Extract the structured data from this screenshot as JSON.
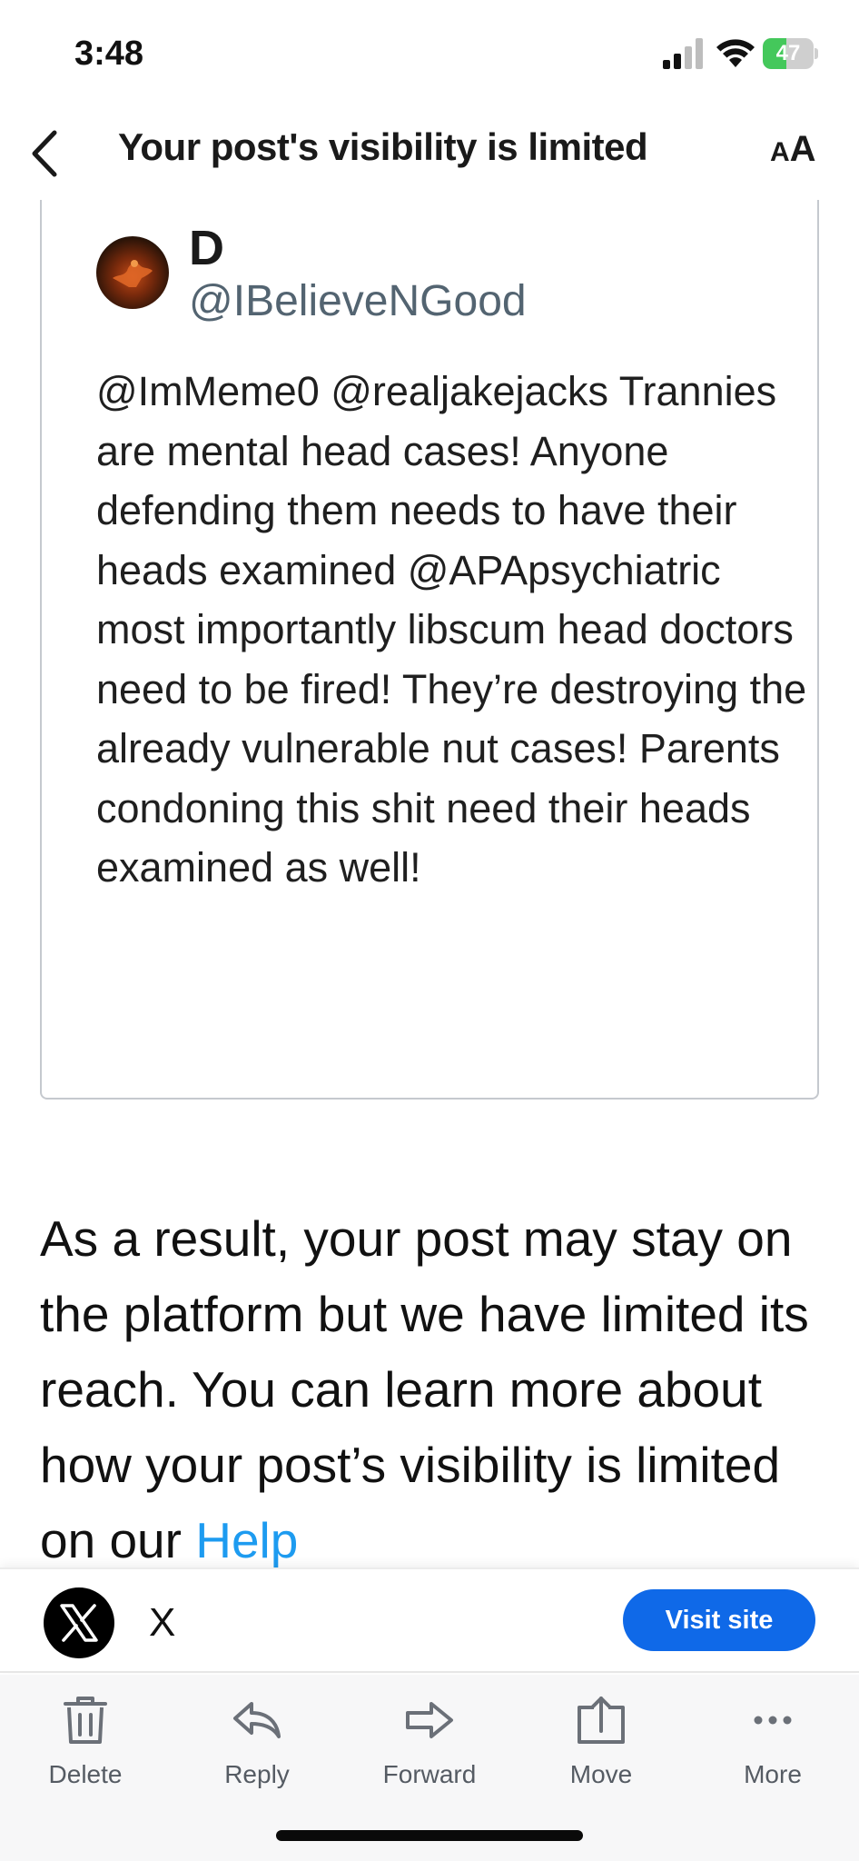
{
  "status_bar": {
    "time": "3:48",
    "battery_level": "47",
    "battery_fraction": 0.47,
    "battery_color": "#44c85b"
  },
  "header": {
    "title": "Your post's visibility is limited",
    "text_size_icon": "AA"
  },
  "tweet": {
    "name": "D",
    "handle": "@IBelieveNGood",
    "text": "@ImMeme0 @realjakejacks Trannies are mental head cases! Anyone defending them needs to have their heads examined @APApsychiatric most importantly libscum head doctors need to be fired! They’re destroying the already vulnerable nut cases! Parents condoning this shit need their heads examined as well!"
  },
  "body": {
    "paragraph": "As a result, your post may stay on the platform but we have limited its reach. You can learn more about how your post’s visibility is limited on our ",
    "link_text": "Help"
  },
  "sender": {
    "name": "X",
    "visit_label": "Visit site",
    "button_color": "#0f69e8"
  },
  "toolbar": {
    "items": [
      {
        "label": "Delete",
        "icon": "trash-icon"
      },
      {
        "label": "Reply",
        "icon": "reply-icon"
      },
      {
        "label": "Forward",
        "icon": "forward-icon"
      },
      {
        "label": "Move",
        "icon": "move-icon"
      },
      {
        "label": "More",
        "icon": "more-icon"
      }
    ]
  },
  "colors": {
    "link": "#1d9bf0",
    "handle": "#536471"
  }
}
